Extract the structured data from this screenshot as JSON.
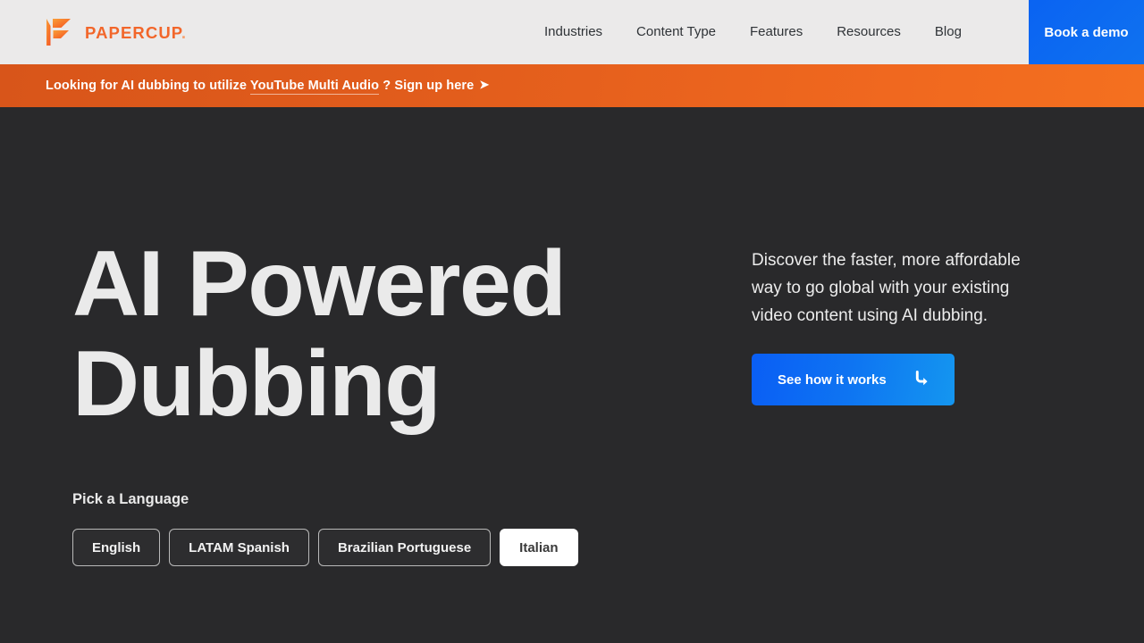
{
  "header": {
    "logo": {
      "icon": "papercup-play-mark-icon",
      "wordmark": "PAPERCUP",
      "wordmark_dot": ".",
      "brand_color": "#f2662a",
      "dot_color": "#f7a271"
    },
    "nav_items": [
      {
        "label": "Industries"
      },
      {
        "label": "Content Type"
      },
      {
        "label": "Features"
      },
      {
        "label": "Resources"
      },
      {
        "label": "Blog"
      }
    ],
    "cta": {
      "label": "Book a demo",
      "background_color": "#0a6af0"
    },
    "background_color": "#ebeaea"
  },
  "banner": {
    "text_before": "Looking for AI dubbing to utilize ",
    "highlight": "YouTube Multi Audio",
    "text_after": " ? Sign up here",
    "arrow_icon": "➤",
    "gradient_from": "#d8551a",
    "gradient_to": "#f4701f"
  },
  "hero": {
    "headline": "AI Powered\nDubbing",
    "paragraph": "Discover the faster, more affordable way to go global with your existing video content using AI dubbing.",
    "cta": {
      "label": "See how it works",
      "icon": "corner-down-right-arrow-icon",
      "gradient_from": "#0a5ef5",
      "gradient_to": "#1496f0"
    },
    "background_color": "#29292b",
    "text_color": "#eaeaea"
  },
  "language_picker": {
    "title": "Pick a Language",
    "options": [
      {
        "label": "English",
        "selected": false
      },
      {
        "label": "LATAM Spanish",
        "selected": false
      },
      {
        "label": "Brazilian Portuguese",
        "selected": false
      },
      {
        "label": "Italian",
        "selected": true
      }
    ]
  }
}
